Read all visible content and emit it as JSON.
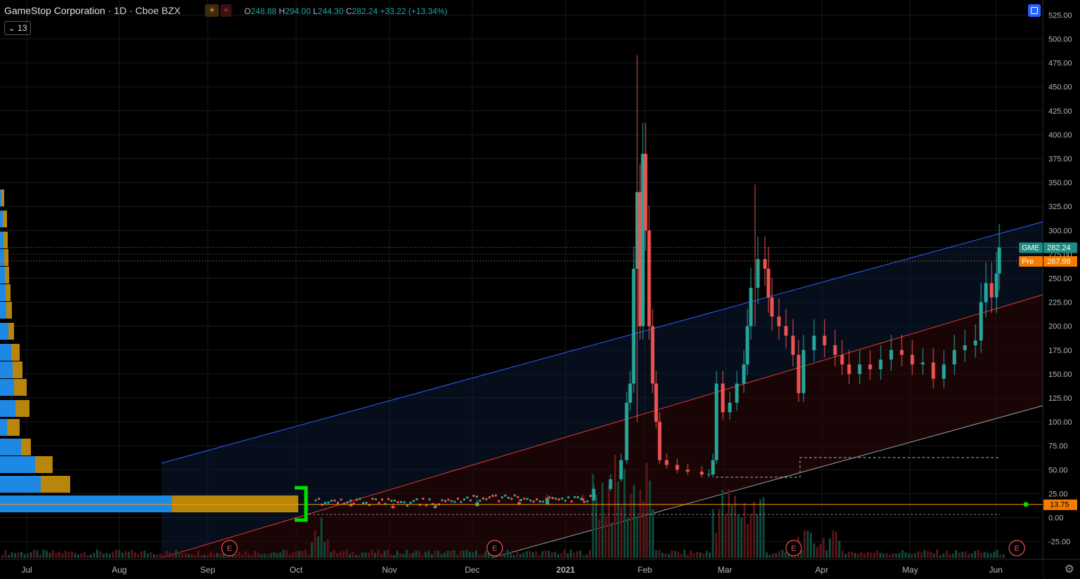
{
  "header": {
    "symbol_name": "GameStop Corporation",
    "interval": "1D",
    "exchange": "Cboe BZX",
    "open_label": "O",
    "open": "248.88",
    "high_label": "H",
    "high": "294.00",
    "low_label": "L",
    "low": "244.30",
    "close_label": "C",
    "close": "282.24",
    "change": "+33.22 (+13.34%)"
  },
  "indicator_badge": "13",
  "badges": {
    "gme_label": "GME",
    "gme_value": "282.24",
    "pre_label": "Pre",
    "pre_value": "267.98",
    "level_value": "13.75"
  },
  "earnings_marker": "E",
  "colors": {
    "up": "#26a69a",
    "down": "#ef5350",
    "background": "#000000",
    "upper_channel": "#2962ff",
    "mid_channel": "#e53935",
    "lower_channel": "#9e9e9e",
    "level_line": "#ff9800",
    "volume_profile_blue": "#1e88e5",
    "volume_profile_gold": "#b8860b",
    "highlight_bracket": "#00e000"
  },
  "chart_data": {
    "type": "candlestick",
    "y_axis_ticks": [
      "525.00",
      "500.00",
      "475.00",
      "450.00",
      "425.00",
      "400.00",
      "375.00",
      "350.00",
      "325.00",
      "300.00",
      "275.00",
      "250.00",
      "225.00",
      "200.00",
      "175.00",
      "150.00",
      "125.00",
      "100.00",
      "75.00",
      "50.00",
      "25.00",
      "0.00",
      "-25.00"
    ],
    "x_axis_labels": [
      "Jul",
      "Aug",
      "Sep",
      "Oct",
      "Nov",
      "Dec",
      "2021",
      "Feb",
      "Mar",
      "Apr",
      "May",
      "Jun"
    ],
    "ylim": [
      -35,
      535
    ],
    "last_price": 282.24,
    "premarket_price": 267.98,
    "horizontal_level": 13.75,
    "earnings_dates": [
      "Sep",
      "Dec",
      "Mar",
      "Jun"
    ],
    "approx_series": [
      {
        "date": "2020-10",
        "close": 13.5
      },
      {
        "date": "2020-11",
        "close": 11.0
      },
      {
        "date": "2020-12",
        "close": 15.0
      },
      {
        "date": "2021-01-13",
        "close": 31.4
      },
      {
        "date": "2021-01-22",
        "close": 65.0
      },
      {
        "date": "2021-01-27",
        "close": 347.5
      },
      {
        "date": "2021-01-28",
        "close": 193.6
      },
      {
        "date": "2021-02-02",
        "close": 90.0
      },
      {
        "date": "2021-02-19",
        "close": 40.6
      },
      {
        "date": "2021-02-24",
        "close": 91.7
      },
      {
        "date": "2021-03-10",
        "close": 265.0
      },
      {
        "date": "2021-03-24",
        "close": 120.3
      },
      {
        "date": "2021-04-15",
        "close": 155.0
      },
      {
        "date": "2021-05-13",
        "close": 142.0
      },
      {
        "date": "2021-05-26",
        "close": 242.6
      },
      {
        "date": "2021-06-01",
        "close": 282.24
      }
    ]
  }
}
